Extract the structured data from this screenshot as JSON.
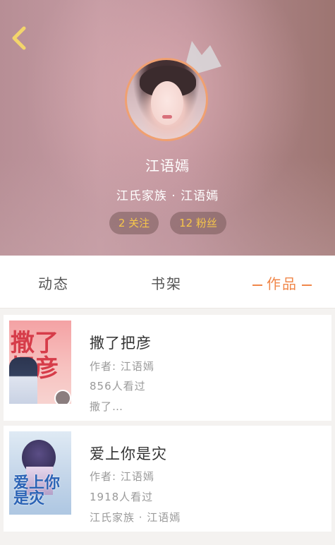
{
  "profile": {
    "name": "江语嫣",
    "family": "江氏家族 · 江语嫣",
    "follow_label": "2 关注",
    "fans_label": "12 粉丝"
  },
  "tabs": {
    "dynamics": "动态",
    "bookshelf": "书架",
    "works": "作品",
    "active": "works"
  },
  "works": [
    {
      "title": "撒了把彦",
      "author": "作者: 江语嫣",
      "views": "856人看过",
      "desc": "撒了…",
      "cover_text": "撒了把彦"
    },
    {
      "title": "爱上你是灾",
      "author": "作者: 江语嫣",
      "views": "1918人看过",
      "desc": "江氏家族 · 江语嫣",
      "cover_text": "爱上你是灾"
    }
  ],
  "colors": {
    "accent": "#f0874a",
    "badge_text": "#f6c64a"
  },
  "icons": {
    "back": "chevron-left-icon",
    "crown": "crown-icon"
  }
}
